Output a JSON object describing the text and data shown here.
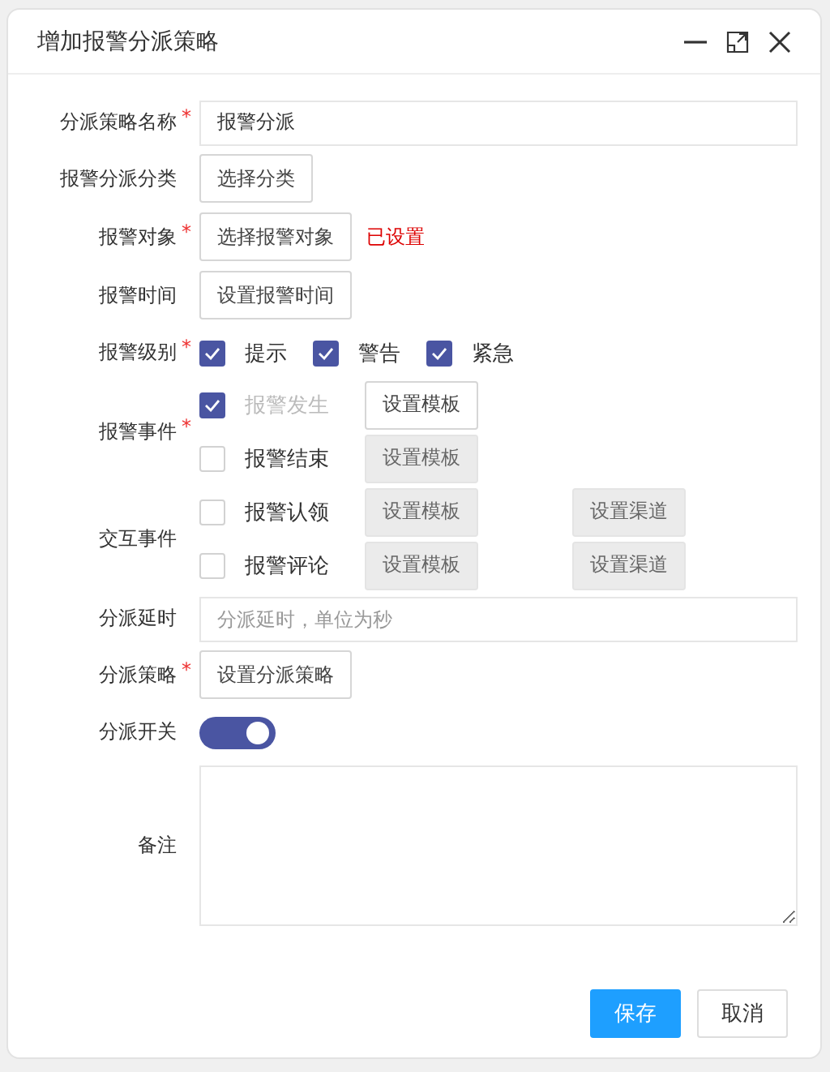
{
  "dialog": {
    "title": "增加报警分派策略"
  },
  "fields": [
    {
      "kind": "input",
      "label": "分派策略名称",
      "required_mark": "*",
      "value": "报警分派"
    },
    {
      "kind": "button",
      "label": "报警分派分类",
      "button": "选择分类"
    },
    {
      "kind": "button",
      "label": "报警对象",
      "required_mark": "*",
      "button": "选择报警对象",
      "status": "已设置"
    },
    {
      "kind": "button",
      "label": "报警时间",
      "button": "设置报警时间"
    },
    {
      "kind": "checks",
      "label": "报警级别",
      "required_mark": "*",
      "options": [
        {
          "label": "提示",
          "checked": true
        },
        {
          "label": "警告",
          "checked": true
        },
        {
          "label": "紧急",
          "checked": true
        }
      ]
    },
    {
      "kind": "events",
      "label": "报警事件",
      "required_mark": "*",
      "events": [
        {
          "label": "报警发生",
          "checked": true,
          "disabled": true,
          "template": {
            "label": "设置模板",
            "disabled": false
          }
        },
        {
          "label": "报警结束",
          "checked": false,
          "disabled": false,
          "template": {
            "label": "设置模板",
            "disabled": true
          }
        }
      ]
    },
    {
      "kind": "events",
      "label": "交互事件",
      "events": [
        {
          "label": "报警认领",
          "checked": false,
          "disabled": false,
          "template": {
            "label": "设置模板",
            "disabled": true
          },
          "channel": {
            "label": "设置渠道",
            "disabled": true
          }
        },
        {
          "label": "报警评论",
          "checked": false,
          "disabled": false,
          "template": {
            "label": "设置模板",
            "disabled": true
          },
          "channel": {
            "label": "设置渠道",
            "disabled": true
          }
        }
      ]
    },
    {
      "kind": "input",
      "label": "分派延时",
      "placeholder": "分派延时，单位为秒"
    },
    {
      "kind": "button",
      "label": "分派策略",
      "required_mark": "*",
      "button": "设置分派策略"
    },
    {
      "kind": "switch",
      "label": "分派开关",
      "on": true
    },
    {
      "kind": "textarea",
      "label": "备注"
    }
  ],
  "actions": [
    {
      "label": "保存",
      "primary": true
    },
    {
      "label": "取消",
      "primary": false
    }
  ]
}
